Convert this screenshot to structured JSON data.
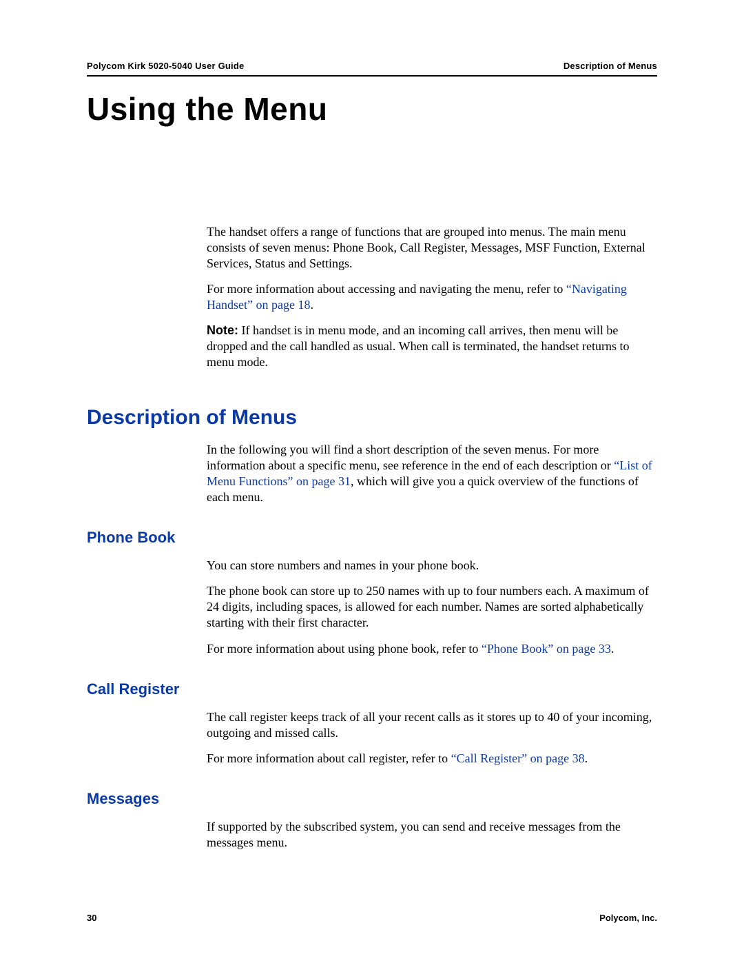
{
  "header": {
    "left": "Polycom Kirk 5020-5040 User Guide",
    "right": "Description of Menus"
  },
  "chapter_title": "Using the Menu",
  "intro": {
    "p1": "The handset offers a range of functions that are grouped into menus. The main menu consists of seven menus: Phone Book, Call Register, Messages, MSF Function, External Services, Status and Settings.",
    "p2_pre": "For more information about accessing and navigating the menu, refer to ",
    "p2_link": "“Navigating Handset” on page 18",
    "p2_post": ".",
    "note_label": "Note:",
    "note_body": " If handset is in menu mode, and an incoming call arrives, then menu will be dropped and the call handled as usual. When call is terminated, the handset returns to menu mode."
  },
  "section_description": {
    "heading": "Description of Menus",
    "p1_pre": "In the following you will find a short description of the seven menus. For more information about a specific menu, see reference in the end of each description or ",
    "p1_link": "“List of Menu Functions” on page 31",
    "p1_post": ", which will give you a quick overview of the functions of each menu."
  },
  "phone_book": {
    "heading": "Phone Book",
    "p1": "You can store numbers and names in your phone book.",
    "p2": "The phone book can store up to 250 names with up to four numbers each. A maximum of 24 digits, including spaces, is allowed for each number. Names are sorted alphabetically starting with their first character.",
    "p3_pre": "For more information about using phone book, refer to ",
    "p3_link": "“Phone Book” on page 33",
    "p3_post": "."
  },
  "call_register": {
    "heading": "Call Register",
    "p1": "The call register keeps track of all your recent calls as it stores up to 40 of your incoming, outgoing and missed calls.",
    "p2_pre": "For more information about call register, refer to ",
    "p2_link": "“Call Register” on page 38",
    "p2_post": "."
  },
  "messages": {
    "heading": "Messages",
    "p1": "If supported by the subscribed system, you can send and receive messages from the messages menu."
  },
  "footer": {
    "page_number": "30",
    "company": "Polycom, Inc."
  }
}
